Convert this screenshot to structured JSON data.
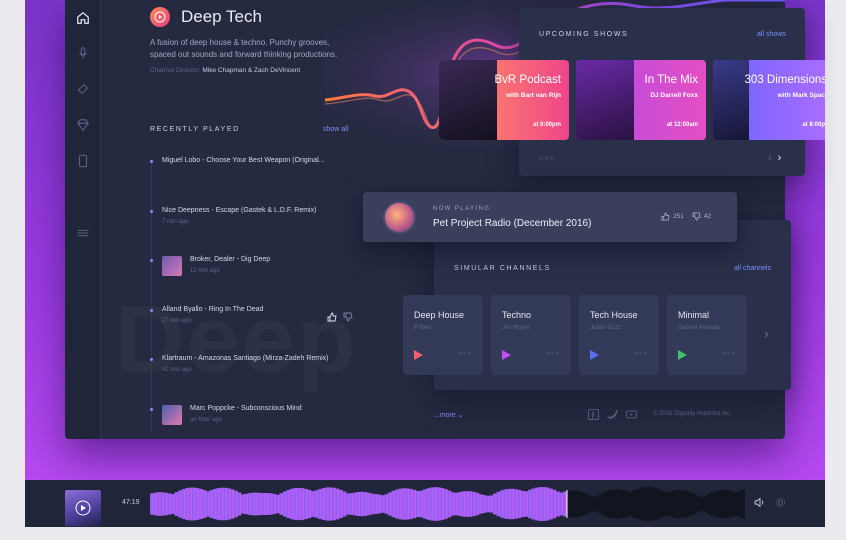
{
  "header": {
    "title": "Deep Tech",
    "description": "A fusion of deep house & techno. Punchy grooves, spaced out sounds and forward thinking productions.",
    "directors_label": "Channel Director:",
    "directors_names": "Mike Chapman & Zach DeVincent",
    "watermark": "Deep"
  },
  "recently_played": {
    "title": "RECENTLY PLAYED",
    "show_all": "show all",
    "tracks": [
      {
        "title": "Miguel Lobo - Choose Your Best Weapon (Original...",
        "time": ""
      },
      {
        "title": "Nice Deepness - Escape (Gastek & L.D.F. Remix)",
        "time": "7 min ago"
      },
      {
        "title": "Broker, Dealer - Dig Deep",
        "time": "12 min ago"
      },
      {
        "title": "Alland Byallo - Ring In The Dead",
        "time": "27 min ago"
      },
      {
        "title": "Klartraum - Amazonas Santiago (Mirza-Zadeh Remix)",
        "time": "42 min ago"
      },
      {
        "title": "Marc Poppcke - Subconscious Mind",
        "time": "an hour ago"
      }
    ]
  },
  "upcoming_shows": {
    "title": "UPCOMING SHOWS",
    "all_shows": "all shows",
    "shows": [
      {
        "name": "BvR Podcast",
        "host": "with Bart van Rijn",
        "time": "at 9:00pm",
        "color_from": "#ff9a5c",
        "color_to": "#f0458a"
      },
      {
        "name": "In The Mix",
        "host": "DJ Darrell Foxx",
        "time": "at 12:00am",
        "color_from": "#b04ae8",
        "color_to": "#e44fc2"
      },
      {
        "name": "303 Dimensions",
        "host": "with Mark Spac",
        "time": "at 8:00p",
        "color_from": "#6a64ff",
        "color_to": "#a86cff"
      }
    ]
  },
  "now_playing": {
    "label": "NOW PLAYING",
    "title": "Pet Project Radio (December 2016)",
    "likes": "251",
    "dislikes": "42"
  },
  "similar_channels": {
    "title": "SIMULAR CHANNELS",
    "all_channels": "all channels",
    "channels": [
      {
        "name": "Deep House",
        "dj": "P-Ben",
        "play_color": "#ff5e6c"
      },
      {
        "name": "Techno",
        "dj": "Jon Hoyer",
        "play_color": "#c44dff"
      },
      {
        "name": "Tech House",
        "dj": "Julian Guzz",
        "play_color": "#5c6cff"
      },
      {
        "name": "Minimal",
        "dj": "Gabriel Ananda",
        "play_color": "#3fc46a"
      }
    ]
  },
  "footer": {
    "more": "...more",
    "copyright": "© 2016 Digitally Imported Inc."
  },
  "player": {
    "time": "47:19",
    "progress": 0.7
  }
}
